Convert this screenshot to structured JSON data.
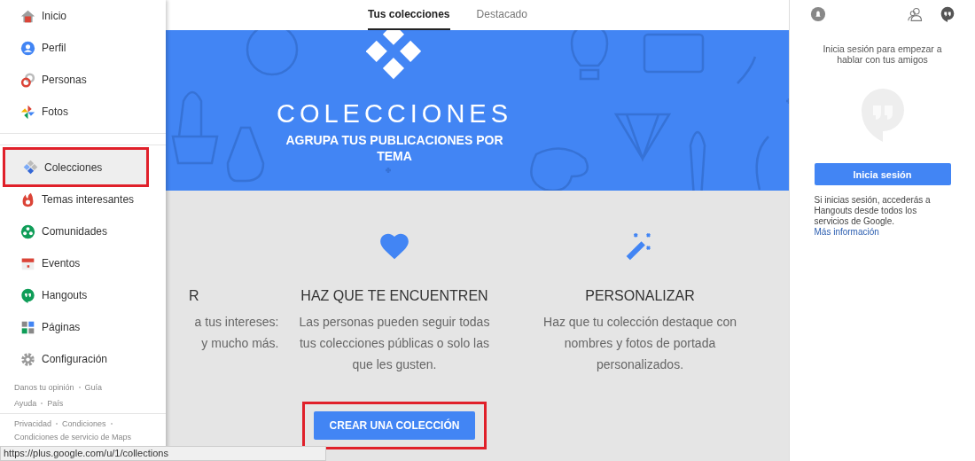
{
  "tabs": [
    {
      "label": "Tus colecciones",
      "selected": true
    },
    {
      "label": "Destacado",
      "selected": false
    }
  ],
  "banner": {
    "title": "COLECCIONES",
    "subtitle": "AGRUPA TUS PUBLICACIONES POR TEMA"
  },
  "features": [
    {
      "title": "R",
      "lines": [
        "a tus intereses:",
        "y mucho más."
      ]
    },
    {
      "title": "HAZ QUE TE ENCUENTREN",
      "lines": [
        "Las personas pueden seguir todas",
        "tus colecciones públicas o solo las",
        "que les gusten."
      ]
    },
    {
      "title": "PERSONALIZAR",
      "lines": [
        "Haz que tu colección destaque con",
        "nombres y fotos de portada",
        "personalizados."
      ]
    }
  ],
  "create_button": {
    "label": "CREAR UNA COLECCIÓN",
    "highlighted": true
  },
  "nav": {
    "items": [
      {
        "label": "Inicio",
        "selected": false,
        "highlighted": false
      },
      {
        "label": "Perfil",
        "selected": false,
        "highlighted": false
      },
      {
        "label": "Personas",
        "selected": false,
        "highlighted": false
      },
      {
        "label": "Fotos",
        "selected": false,
        "highlighted": false
      },
      {
        "label": "Colecciones",
        "selected": true,
        "highlighted": true
      },
      {
        "label": "Temas interesantes",
        "selected": false,
        "highlighted": false
      },
      {
        "label": "Comunidades",
        "selected": false,
        "highlighted": false
      },
      {
        "label": "Eventos",
        "selected": false,
        "highlighted": false
      },
      {
        "label": "Hangouts",
        "selected": false,
        "highlighted": false
      },
      {
        "label": "Páginas",
        "selected": false,
        "highlighted": false
      },
      {
        "label": "Configuración",
        "selected": false,
        "highlighted": false
      }
    ],
    "footer_groups": [
      [
        "Danos tu opinión",
        "Guía",
        "Ayuda",
        "País"
      ],
      [
        "Privacidad",
        "Condiciones",
        "Condiciones de servicio de Maps"
      ]
    ]
  },
  "hangouts": {
    "prompt": "Inicia sesión para empezar a hablar con tus amigos",
    "button": "Inicia sesión",
    "info": "Si inicias sesión, accederás a Hangouts desde todos los servicios de Google.",
    "link": "Más información"
  },
  "status_bar": "https://plus.google.com/u/1/collections"
}
